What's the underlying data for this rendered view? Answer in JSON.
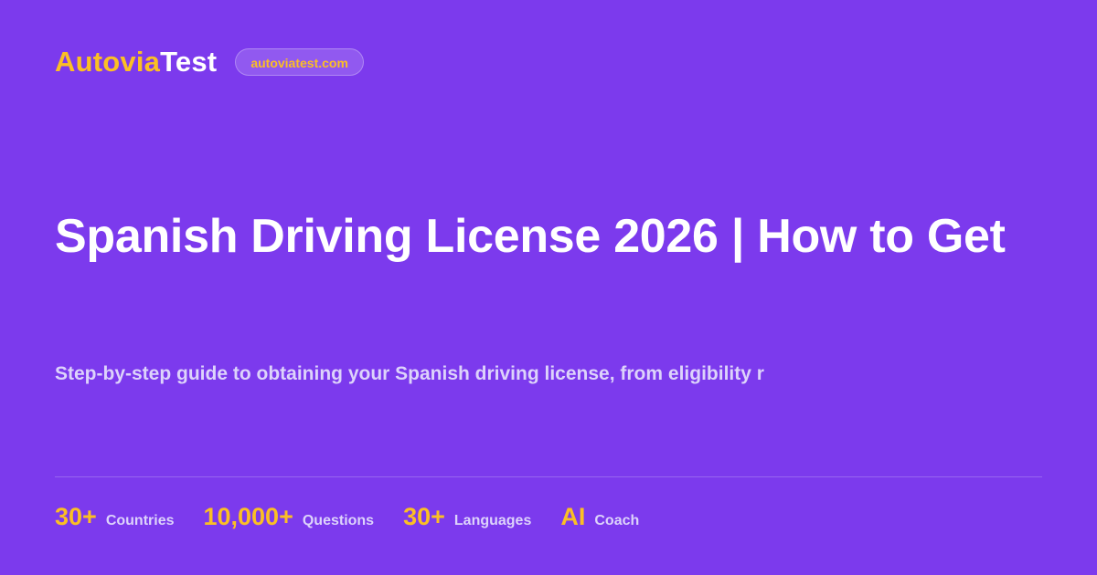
{
  "brand": {
    "name_part1": "Autovia",
    "name_part2": "Test",
    "domain": "autoviatest.com"
  },
  "title": "Spanish Driving License 2026 | How to Get",
  "subtitle": "Step-by-step guide to obtaining your Spanish driving license, from eligibility r",
  "stats": [
    {
      "value": "30+",
      "label": "Countries"
    },
    {
      "value": "10,000+",
      "label": "Questions"
    },
    {
      "value": "30+",
      "label": "Languages"
    },
    {
      "value": "AI",
      "label": "Coach"
    }
  ],
  "colors": {
    "background": "#7c3aed",
    "accent": "#fbbf24",
    "text": "#ffffff",
    "muted": "#ddd3fb"
  }
}
